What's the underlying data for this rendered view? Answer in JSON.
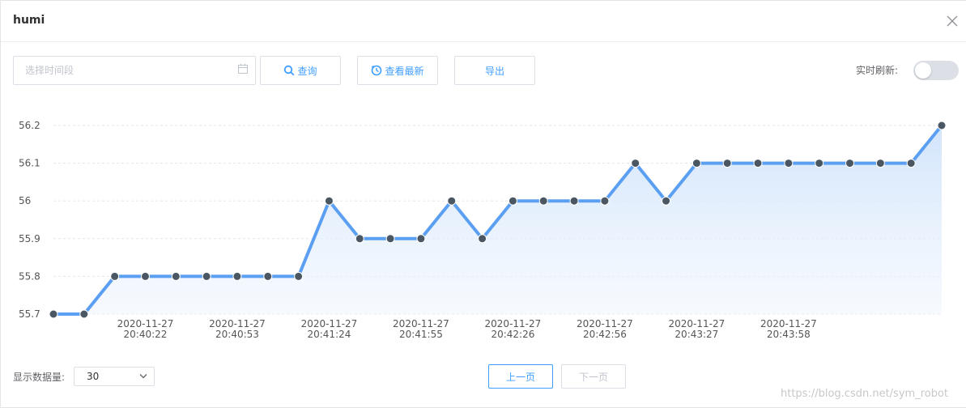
{
  "dialog": {
    "title": "humi",
    "close_icon": "close-icon"
  },
  "toolbar": {
    "date_placeholder": "选择时间段",
    "query_label": "查询",
    "latest_label": "查看最新",
    "export_label": "导出",
    "refresh_label": "实时刷新:",
    "refresh_on": false
  },
  "footer": {
    "count_label": "显示数据量:",
    "count_value": "30",
    "prev_label": "上一页",
    "next_label": "下一页",
    "watermark": "https://blog.csdn.net/sym_robot"
  },
  "colors": {
    "accent": "#409eff",
    "line": "#5b9ff2",
    "point": "#4a5763"
  },
  "chart_data": {
    "type": "area",
    "y_ticks": [
      "55.7",
      "55.8",
      "55.9",
      "56",
      "56.1",
      "56.2"
    ],
    "ylim": [
      55.7,
      56.2
    ],
    "x_labels": [
      {
        "date": "2020-11-27",
        "time": "20:40:22",
        "index": 3
      },
      {
        "date": "2020-11-27",
        "time": "20:40:53",
        "index": 6
      },
      {
        "date": "2020-11-27",
        "time": "20:41:24",
        "index": 9
      },
      {
        "date": "2020-11-27",
        "time": "20:41:55",
        "index": 12
      },
      {
        "date": "2020-11-27",
        "time": "20:42:26",
        "index": 15
      },
      {
        "date": "2020-11-27",
        "time": "20:42:56",
        "index": 18
      },
      {
        "date": "2020-11-27",
        "time": "20:43:27",
        "index": 21
      },
      {
        "date": "2020-11-27",
        "time": "20:43:58",
        "index": 24
      }
    ],
    "values": [
      55.7,
      55.7,
      55.8,
      55.8,
      55.8,
      55.8,
      55.8,
      55.8,
      55.8,
      56.0,
      55.9,
      55.9,
      55.9,
      56.0,
      55.9,
      56.0,
      56.0,
      56.0,
      56.0,
      56.1,
      56.0,
      56.1,
      56.1,
      56.1,
      56.1,
      56.1,
      56.1,
      56.1,
      56.1,
      56.2
    ],
    "grid": true
  }
}
